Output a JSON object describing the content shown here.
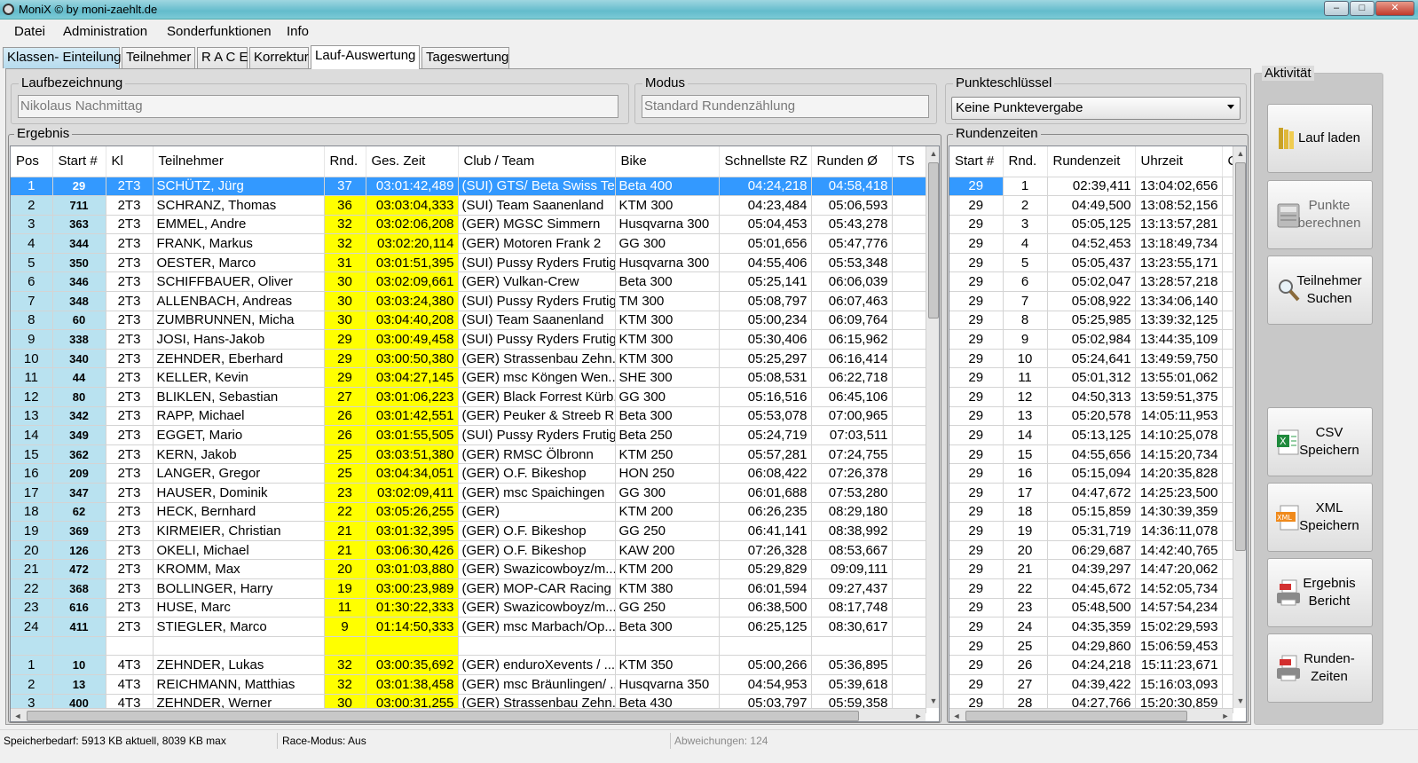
{
  "window": {
    "title": "MoniX © by moni-zaehlt.de",
    "btn_min": "–",
    "btn_max": "□",
    "btn_close": "✕"
  },
  "menu": [
    "Datei",
    "Administration",
    "Sonderfunktionen",
    "Info"
  ],
  "tabs": [
    "Klassen- Einteilung",
    "Teilnehmer",
    "R A C E",
    "Korrektur",
    "Lauf-Auswertung",
    "Tageswertung"
  ],
  "laufbezeichnung": {
    "label": "Laufbezeichnung",
    "value": "Nikolaus Nachmittag"
  },
  "modus": {
    "label": "Modus",
    "value": "Standard Rundenzählung"
  },
  "punkteschluessel": {
    "label": "Punkteschlüssel",
    "value": "Keine  Punktevergabe"
  },
  "ergebnis": {
    "label": "Ergebnis",
    "columns": [
      "Pos",
      "Start #",
      "Kl",
      "Teilnehmer",
      "Rnd.",
      "Ges. Zeit",
      "Club / Team",
      "Bike",
      "Schnellste RZ",
      "Runden Ø",
      "TS"
    ],
    "rows": [
      [
        "1",
        "29",
        "2T3",
        "SCHÜTZ, Jürg",
        "37",
        "03:01:42,489",
        "(SUI) GTS/ Beta Swiss Te...",
        "Beta 400",
        "04:24,218",
        "04:58,418",
        ""
      ],
      [
        "2",
        "711",
        "2T3",
        "SCHRANZ, Thomas",
        "36",
        "03:03:04,333",
        "(SUI) Team Saanenland",
        "KTM 300",
        "04:23,484",
        "05:06,593",
        ""
      ],
      [
        "3",
        "363",
        "2T3",
        "EMMEL, Andre",
        "32",
        "03:02:06,208",
        "(GER) MGSC Simmern",
        "Husqvarna 300",
        "05:04,453",
        "05:43,278",
        ""
      ],
      [
        "4",
        "344",
        "2T3",
        "FRANK, Markus",
        "32",
        "03:02:20,114",
        "(GER) Motoren Frank 2",
        "GG 300",
        "05:01,656",
        "05:47,776",
        ""
      ],
      [
        "5",
        "350",
        "2T3",
        "OESTER, Marco",
        "31",
        "03:01:51,395",
        "(SUI) Pussy Ryders Frutig...",
        "Husqvarna 300",
        "04:55,406",
        "05:53,348",
        ""
      ],
      [
        "6",
        "346",
        "2T3",
        "SCHIFFBAUER, Oliver",
        "30",
        "03:02:09,661",
        "(GER) Vulkan-Crew",
        "Beta 300",
        "05:25,141",
        "06:06,039",
        ""
      ],
      [
        "7",
        "348",
        "2T3",
        "ALLENBACH, Andreas",
        "30",
        "03:03:24,380",
        "(SUI) Pussy Ryders Frutig...",
        "TM 300",
        "05:08,797",
        "06:07,463",
        ""
      ],
      [
        "8",
        "60",
        "2T3",
        "ZUMBRUNNEN, Micha",
        "30",
        "03:04:40,208",
        "(SUI) Team Saanenland",
        "KTM 300",
        "05:00,234",
        "06:09,764",
        ""
      ],
      [
        "9",
        "338",
        "2T3",
        "JOSI, Hans-Jakob",
        "29",
        "03:00:49,458",
        "(SUI) Pussy Ryders Frutig...",
        "KTM 300",
        "05:30,406",
        "06:15,962",
        ""
      ],
      [
        "10",
        "340",
        "2T3",
        "ZEHNDER, Eberhard",
        "29",
        "03:00:50,380",
        "(GER) Strassenbau Zehn...",
        "KTM 300",
        "05:25,297",
        "06:16,414",
        ""
      ],
      [
        "11",
        "44",
        "2T3",
        "KELLER, Kevin",
        "29",
        "03:04:27,145",
        "(GER) msc Köngen Wen...",
        "SHE 300",
        "05:08,531",
        "06:22,718",
        ""
      ],
      [
        "12",
        "80",
        "2T3",
        "BLIKLEN, Sebastian",
        "27",
        "03:01:06,223",
        "(GER) Black Forrest Kürb...",
        "GG 300",
        "05:16,516",
        "06:45,106",
        ""
      ],
      [
        "13",
        "342",
        "2T3",
        "RAPP, Michael",
        "26",
        "03:01:42,551",
        "(GER) Peuker & Streeb R...",
        "Beta 300",
        "05:53,078",
        "07:00,965",
        ""
      ],
      [
        "14",
        "349",
        "2T3",
        "EGGET, Mario",
        "26",
        "03:01:55,505",
        "(SUI) Pussy Ryders Frutig...",
        "Beta 250",
        "05:24,719",
        "07:03,511",
        ""
      ],
      [
        "15",
        "362",
        "2T3",
        "KERN, Jakob",
        "25",
        "03:03:51,380",
        "(GER) RMSC Ölbronn",
        "KTM 250",
        "05:57,281",
        "07:24,755",
        ""
      ],
      [
        "16",
        "209",
        "2T3",
        "LANGER, Gregor",
        "25",
        "03:04:34,051",
        "(GER) O.F. Bikeshop",
        "HON 250",
        "06:08,422",
        "07:26,378",
        ""
      ],
      [
        "17",
        "347",
        "2T3",
        "HAUSER, Dominik",
        "23",
        "03:02:09,411",
        "(GER) msc Spaichingen",
        "GG 300",
        "06:01,688",
        "07:53,280",
        ""
      ],
      [
        "18",
        "62",
        "2T3",
        "HECK, Bernhard",
        "22",
        "03:05:26,255",
        "(GER)",
        "KTM 200",
        "06:26,235",
        "08:29,180",
        ""
      ],
      [
        "19",
        "369",
        "2T3",
        "KIRMEIER, Christian",
        "21",
        "03:01:32,395",
        "(GER) O.F. Bikeshop",
        "GG 250",
        "06:41,141",
        "08:38,992",
        ""
      ],
      [
        "20",
        "126",
        "2T3",
        "OKELI, Michael",
        "21",
        "03:06:30,426",
        "(GER) O.F. Bikeshop",
        "KAW 200",
        "07:26,328",
        "08:53,667",
        ""
      ],
      [
        "21",
        "472",
        "2T3",
        "KROMM, Max",
        "20",
        "03:01:03,880",
        "(GER) Swazicowboyz/m...",
        "KTM 200",
        "05:29,829",
        "09:09,111",
        ""
      ],
      [
        "22",
        "368",
        "2T3",
        "BOLLINGER, Harry",
        "19",
        "03:00:23,989",
        "(GER) MOP-CAR Racing",
        "KTM 380",
        "06:01,594",
        "09:27,437",
        ""
      ],
      [
        "23",
        "616",
        "2T3",
        "HUSE, Marc",
        "11",
        "01:30:22,333",
        "(GER) Swazicowboyz/m...",
        "GG 250",
        "06:38,500",
        "08:17,748",
        ""
      ],
      [
        "24",
        "411",
        "2T3",
        "STIEGLER, Marco",
        "9",
        "01:14:50,333",
        "(GER) msc Marbach/Op...",
        "Beta 300",
        "06:25,125",
        "08:30,617",
        ""
      ],
      [
        "",
        "",
        "",
        "",
        "",
        "",
        "",
        "",
        "",
        "",
        ""
      ],
      [
        "1",
        "10",
        "4T3",
        "ZEHNDER, Lukas",
        "32",
        "03:00:35,692",
        "(GER) enduroXevents / ...",
        "KTM 350",
        "05:00,266",
        "05:36,895",
        ""
      ],
      [
        "2",
        "13",
        "4T3",
        "REICHMANN, Matthias",
        "32",
        "03:01:38,458",
        "(GER) msc Bräunlingen/ ...",
        "Husqvarna 350",
        "04:54,953",
        "05:39,618",
        ""
      ],
      [
        "3",
        "400",
        "4T3",
        "ZEHNDER, Werner",
        "30",
        "03:00:31,255",
        "(GER) Strassenbau Zehn...",
        "Beta 430",
        "05:03,797",
        "05:59,358",
        ""
      ]
    ]
  },
  "rundenzeiten": {
    "label": "Rundenzeiten",
    "columns": [
      "Start #",
      "Rnd.",
      "Rundenzeit",
      "Uhrzeit",
      "C"
    ],
    "rows": [
      [
        "29",
        "1",
        "02:39,411",
        "13:04:02,656"
      ],
      [
        "29",
        "2",
        "04:49,500",
        "13:08:52,156"
      ],
      [
        "29",
        "3",
        "05:05,125",
        "13:13:57,281"
      ],
      [
        "29",
        "4",
        "04:52,453",
        "13:18:49,734"
      ],
      [
        "29",
        "5",
        "05:05,437",
        "13:23:55,171"
      ],
      [
        "29",
        "6",
        "05:02,047",
        "13:28:57,218"
      ],
      [
        "29",
        "7",
        "05:08,922",
        "13:34:06,140"
      ],
      [
        "29",
        "8",
        "05:25,985",
        "13:39:32,125"
      ],
      [
        "29",
        "9",
        "05:02,984",
        "13:44:35,109"
      ],
      [
        "29",
        "10",
        "05:24,641",
        "13:49:59,750"
      ],
      [
        "29",
        "11",
        "05:01,312",
        "13:55:01,062"
      ],
      [
        "29",
        "12",
        "04:50,313",
        "13:59:51,375"
      ],
      [
        "29",
        "13",
        "05:20,578",
        "14:05:11,953"
      ],
      [
        "29",
        "14",
        "05:13,125",
        "14:10:25,078"
      ],
      [
        "29",
        "15",
        "04:55,656",
        "14:15:20,734"
      ],
      [
        "29",
        "16",
        "05:15,094",
        "14:20:35,828"
      ],
      [
        "29",
        "17",
        "04:47,672",
        "14:25:23,500"
      ],
      [
        "29",
        "18",
        "05:15,859",
        "14:30:39,359"
      ],
      [
        "29",
        "19",
        "05:31,719",
        "14:36:11,078"
      ],
      [
        "29",
        "20",
        "06:29,687",
        "14:42:40,765"
      ],
      [
        "29",
        "21",
        "04:39,297",
        "14:47:20,062"
      ],
      [
        "29",
        "22",
        "04:45,672",
        "14:52:05,734"
      ],
      [
        "29",
        "23",
        "05:48,500",
        "14:57:54,234"
      ],
      [
        "29",
        "24",
        "04:35,359",
        "15:02:29,593"
      ],
      [
        "29",
        "25",
        "04:29,860",
        "15:06:59,453"
      ],
      [
        "29",
        "26",
        "04:24,218",
        "15:11:23,671"
      ],
      [
        "29",
        "27",
        "04:39,422",
        "15:16:03,093"
      ],
      [
        "29",
        "28",
        "04:27,766",
        "15:20:30,859"
      ]
    ]
  },
  "aktivitaet": {
    "label": "Aktivität",
    "buttons": [
      {
        "line1": "Lauf laden",
        "line2": "",
        "icon": "folder-icon"
      },
      {
        "line1": "Punkte",
        "line2": "berechnen",
        "icon": "calculator-icon"
      },
      {
        "line1": "Teilnehmer",
        "line2": "Suchen",
        "icon": "magnifier-icon"
      },
      {
        "line1": "CSV",
        "line2": "Speichern",
        "icon": "excel-icon"
      },
      {
        "line1": "XML",
        "line2": "Speichern",
        "icon": "xml-icon"
      },
      {
        "line1": "Ergebnis",
        "line2": "Bericht",
        "icon": "pdf-printer-icon"
      },
      {
        "line1": "Runden-",
        "line2": "Zeiten",
        "icon": "pdf-printer-icon"
      }
    ]
  },
  "status": {
    "memory": "Speicherbedarf: 5913 KB aktuell, 8039 KB max",
    "race_mode": "Race-Modus: Aus",
    "deviations": "Abweichungen: 124"
  },
  "colors": {
    "position_bg": "#b9e2f0",
    "highlight_yellow": "#ffff00",
    "selection": "#3399ff"
  }
}
